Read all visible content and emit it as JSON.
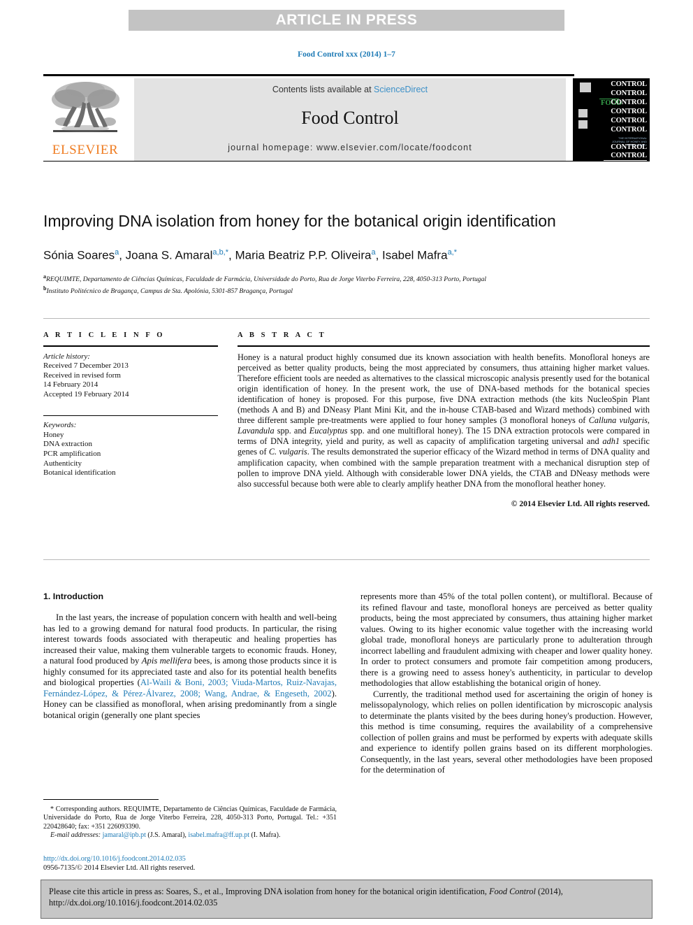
{
  "banner": {
    "text": "ARTICLE IN PRESS"
  },
  "running_head": "Food Control xxx (2014) 1–7",
  "journal_header": {
    "contents_prefix": "Contents lists available at ",
    "sciencedirect": "ScienceDirect",
    "journal_name": "Food Control",
    "homepage": "journal homepage: www.elsevier.com/locate/foodcont",
    "publisher_logo_word": "ELSEVIER",
    "cover": {
      "food_word": "FOOD",
      "control_word": "CONTROL",
      "control_rows": 9,
      "subtitle": "THE INTERNATIONAL JOURNAL OF HONEY AND FOOD SAFETY"
    }
  },
  "article": {
    "title": "Improving DNA isolation from honey for the botanical origin identification",
    "authors_html": "Sónia Soares<sup>a</sup>, Joana S. Amaral<sup>a,b,*</sup>, Maria Beatriz P.P. Oliveira<sup>a</sup>, Isabel Mafra<sup>a,*</sup>",
    "affiliation_a": "REQUIMTE, Departamento de Ciências Químicas, Faculdade de Farmácia, Universidade do Porto, Rua de Jorge Viterbo Ferreira, 228, 4050-313 Porto, Portugal",
    "affiliation_b": "Instituto Politécnico de Bragança, Campus de Sta. Apolónia, 5301-857 Bragança, Portugal",
    "affil_marker_a": "a",
    "affil_marker_b": "b"
  },
  "article_info": {
    "heading": "A R T I C L E  I N F O",
    "history_label": "Article history:",
    "history_lines": [
      "Received 7 December 2013",
      "Received in revised form",
      "14 February 2014",
      "Accepted 19 February 2014"
    ],
    "keywords_label": "Keywords:",
    "keywords": [
      "Honey",
      "DNA extraction",
      "PCR amplification",
      "Authenticity",
      "Botanical identification"
    ]
  },
  "abstract": {
    "heading": "A B S T R A C T",
    "text_html": "Honey is a natural product highly consumed due its known association with health benefits. Monofloral honeys are perceived as better quality products, being the most appreciated by consumers, thus attaining higher market values. Therefore efficient tools are needed as alternatives to the classical microscopic analysis presently used for the botanical origin identification of honey. In the present work, the use of DNA-based methods for the botanical species identification of honey is proposed. For this purpose, five DNA extraction methods (the kits NucleoSpin Plant (methods A and B) and DNeasy Plant Mini Kit, and the in-house CTAB-based and Wizard methods) combined with three different sample pre-treatments were applied to four honey samples (3 monofloral honeys of <em>Calluna vulgaris</em>, <em>Lavandula</em> spp. and <em>Eucalyptus</em> spp. and one multifloral honey). The 15 DNA extraction protocols were compared in terms of DNA integrity, yield and purity, as well as capacity of amplification targeting universal and <em>adh1</em> specific genes of <em>C. vulgaris</em>. The results demonstrated the superior efficacy of the Wizard method in terms of DNA quality and amplification capacity, when combined with the sample preparation treatment with a mechanical disruption step of pollen to improve DNA yield. Although with considerable lower DNA yields, the CTAB and DNeasy methods were also successful because both were able to clearly amplify heather DNA from the monofloral heather honey.",
    "copyright": "© 2014 Elsevier Ltd. All rights reserved."
  },
  "body": {
    "section_heading": "1.  Introduction",
    "left_paragraphs_html": [
      "In the last years, the increase of population concern with health and well-being has led to a growing demand for natural food products. In particular, the rising interest towards foods associated with therapeutic and healing properties has increased their value, making them vulnerable targets to economic frauds. Honey, a natural food produced by <em>Apis mellifera</em> bees, is among those products since it is highly consumed for its appreciated taste and also for its potential health benefits and biological properties (<span class=\"ref\">Al-Waili &amp; Boni, 2003; Viuda-Martos, Ruiz-Navajas, Fernández-López, &amp; Pérez-Álvarez, 2008; Wang, Andrae, &amp; Engeseth, 2002</span>). Honey can be classified as monofloral, when arising predominantly from a single botanical origin (generally one plant species"
    ],
    "right_paragraphs_html": [
      "represents more than 45% of the total pollen content), or multifloral. Because of its refined flavour and taste, monofloral honeys are perceived as better quality products, being the most appreciated by consumers, thus attaining higher market values. Owing to its higher economic value together with the increasing world global trade, monofloral honeys are particularly prone to adulteration through incorrect labelling and fraudulent admixing with cheaper and lower quality honey. In order to protect consumers and promote fair competition among producers, there is a growing need to assess honey's authenticity, in particular to develop methodologies that allow establishing the botanical origin of honey.",
      "Currently, the traditional method used for ascertaining the origin of honey is melissopalynology, which relies on pollen identification by microscopic analysis to determinate the plants visited by the bees during honey's production. However, this method is time consuming, requires the availability of a comprehensive collection of pollen grains and must be performed by experts with adequate skills and experience to identify pollen grains based on its different morphologies. Consequently, in the last years, several other methodologies have been proposed for the determination of"
    ]
  },
  "footnote": {
    "corresponding_html": "* Corresponding authors. REQUIMTE, Departamento de Ciências Químicas, Faculdade de Farmácia, Universidade do Porto, Rua de Jorge Viterbo Ferreira, 228, 4050-313 Porto, Portugal. Tel.: +351 220428640; fax: +351 226093390.",
    "email_label": "E-mail addresses:",
    "email_1": "jamaral@ipb.pt",
    "email_1_owner": "(J.S. Amaral),",
    "email_2": "isabel.mafra@ff.up.pt",
    "email_2_owner": "(I. Mafra).",
    "doi_url": "http://dx.doi.org/10.1016/j.foodcont.2014.02.035",
    "issn_line": "0956-7135/© 2014 Elsevier Ltd. All rights reserved."
  },
  "cite_box": {
    "text_html": "Please cite this article in press as: Soares, S., et al., Improving DNA isolation from honey for the botanical origin identification, <em>Food Control</em> (2014), http://dx.doi.org/10.1016/j.foodcont.2014.02.035"
  },
  "colors": {
    "banner_bg": "#c3c3c3",
    "link_blue": "#1f7bb6",
    "sciencedirect_blue": "#3c90c8",
    "elsevier_orange": "#ef7c21",
    "gray_box": "#e3e3e3",
    "cover_green": "#35a04a",
    "cite_box_bg": "#c6c6c6"
  }
}
